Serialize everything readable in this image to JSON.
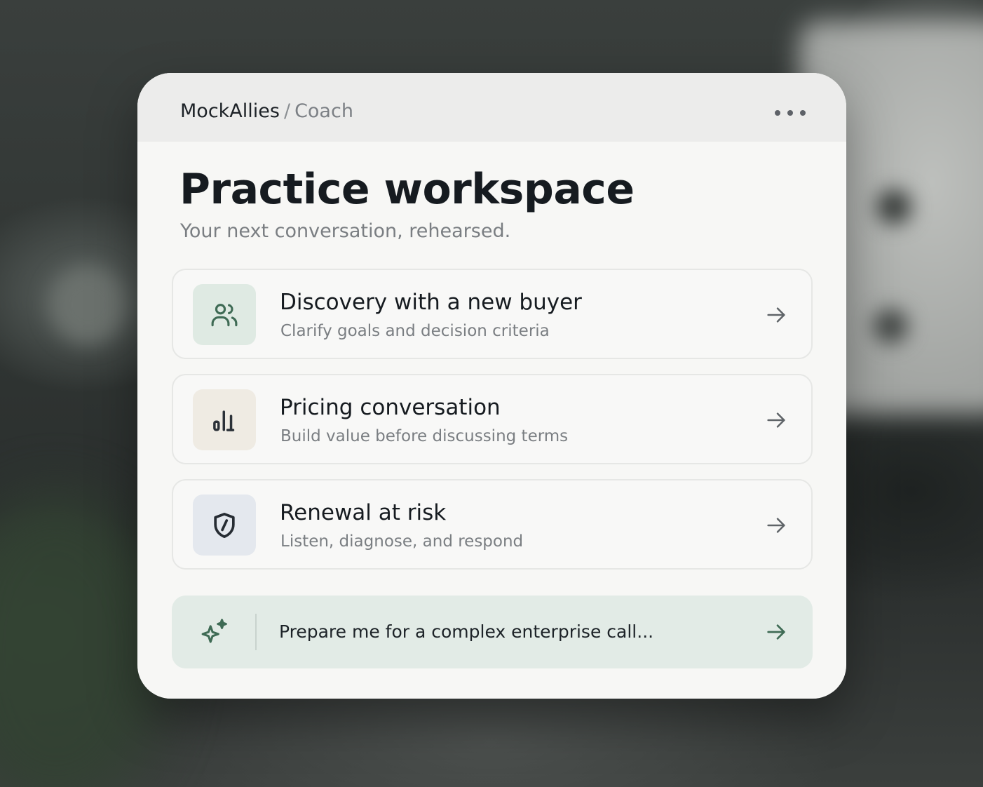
{
  "header": {
    "app_name": "MockAllies",
    "separator": "/",
    "page_name": "Coach",
    "more_icon": "more-horizontal-icon"
  },
  "main": {
    "title": "Practice workspace",
    "subtitle": "Your next conversation, rehearsed."
  },
  "scenarios": [
    {
      "title": "Discovery with a new buyer",
      "description": "Clarify goals and decision criteria",
      "icon": "users-icon",
      "icon_bg": "#dfeae3",
      "icon_color": "#3f6b55"
    },
    {
      "title": "Pricing conversation",
      "description": "Build value before discussing terms",
      "icon": "bar-chart-icon",
      "icon_bg": "#efebe3",
      "icon_color": "#2b3138"
    },
    {
      "title": "Renewal at risk",
      "description": "Listen, diagnose, and respond",
      "icon": "shield-icon",
      "icon_bg": "#e4e8ee",
      "icon_color": "#262c33"
    }
  ],
  "prompt": {
    "text": "Prepare me for a complex enterprise call...",
    "icon": "sparkles-icon",
    "send_icon": "arrow-right-icon",
    "background": "#e2ebe6",
    "accent": "#3f6b55"
  }
}
